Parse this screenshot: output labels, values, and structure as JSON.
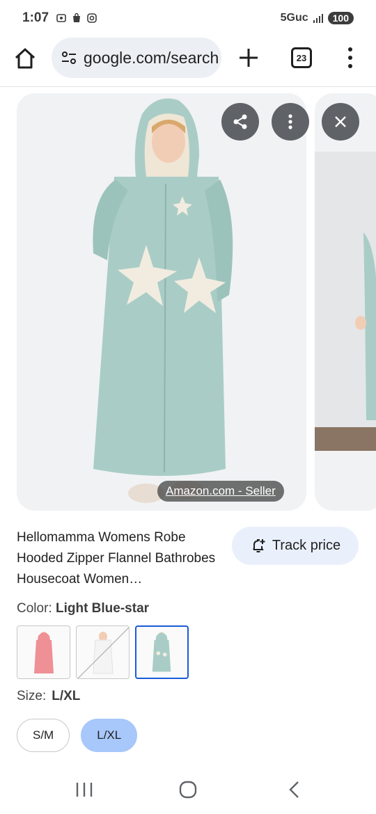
{
  "status_bar": {
    "time": "1:07",
    "network": "5Guc",
    "battery": "100"
  },
  "browser": {
    "url": "google.com/search",
    "tab_count": "23"
  },
  "image": {
    "source_label": "Amazon.com - Seller",
    "robe_color": "#a9cdc6",
    "star_color": "#f2ece0"
  },
  "product": {
    "title": "Hellomamma Womens Robe Hooded Zipper Flannel Bathrobes Housecoat Women…",
    "track_price_label": "Track price",
    "color_label": "Color:",
    "color_value": "Light Blue-star",
    "color_swatches": [
      {
        "name": "pink",
        "color": "#ef8f96",
        "selected": false
      },
      {
        "name": "white",
        "color": "#f4f4f4",
        "selected": false
      },
      {
        "name": "light-blue-star",
        "color": "#a9cdc6",
        "selected": true
      }
    ],
    "size_label": "Size:",
    "size_value": "L/XL",
    "sizes": [
      {
        "label": "S/M",
        "selected": false
      },
      {
        "label": "L/XL",
        "selected": true
      }
    ]
  },
  "colors": {
    "accent": "#1a5bd7",
    "chip_selected": "#a8c7fa",
    "button_bg": "#5f6368"
  }
}
